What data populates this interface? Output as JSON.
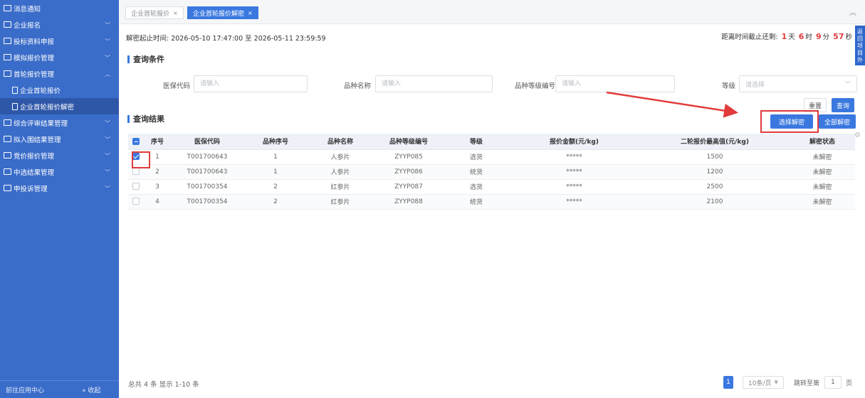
{
  "sidebar": {
    "items": [
      {
        "label": "消息通知",
        "chevron": ""
      },
      {
        "label": "企业报名",
        "chevron": "﹀"
      },
      {
        "label": "投标资料申报",
        "chevron": "﹀"
      },
      {
        "label": "模拟报价管理",
        "chevron": "﹀"
      },
      {
        "label": "首轮报价管理",
        "chevron": "︿"
      },
      {
        "label": "企业首轮报价",
        "chevron": ""
      },
      {
        "label": "企业首轮报价解密",
        "chevron": ""
      },
      {
        "label": "综合评审结果管理",
        "chevron": "﹀"
      },
      {
        "label": "拟入围结果管理",
        "chevron": "﹀"
      },
      {
        "label": "竞价报价管理",
        "chevron": "﹀"
      },
      {
        "label": "中选结果管理",
        "chevron": "﹀"
      },
      {
        "label": "申投诉管理",
        "chevron": "﹀"
      }
    ],
    "bottom_left": "前往应用中心",
    "bottom_right": "« 收起"
  },
  "tabs": [
    {
      "label": "企业首轮报价",
      "close": "×"
    },
    {
      "label": "企业首轮报价解密",
      "close": "×"
    }
  ],
  "top_chevron": "︽",
  "side_float": "返回项目外",
  "info": {
    "decrypt_period": "解密起止时间: 2026-05-10 17:47:00 至 2026-05-11 23:59:59",
    "countdown_prefix": "距离时间截止还剩:",
    "days": "1",
    "days_unit": "天",
    "hours": "6",
    "hours_unit": "时",
    "minutes": "9",
    "minutes_unit": "分",
    "seconds": "57",
    "seconds_unit": "秒"
  },
  "query": {
    "title": "查询条件",
    "fields": [
      {
        "label": "医保代码",
        "placeholder": "请输入"
      },
      {
        "label": "品种名称",
        "placeholder": "请输入"
      },
      {
        "label": "品种等级编号",
        "placeholder": "请输入"
      },
      {
        "label": "等级",
        "placeholder": "请选择"
      }
    ],
    "reset_label": "重置",
    "search_label": "查询"
  },
  "results": {
    "title": "查询结果",
    "select_decrypt_label": "选择解密",
    "decrypt_all_label": "全部解密",
    "columns": [
      "序号",
      "医保代码",
      "品种序号",
      "品种名称",
      "品种等级编号",
      "等级",
      "报价金额(元/kg)",
      "二轮报价最高值(元/kg)",
      "解密状态"
    ],
    "rows": [
      {
        "checked": true,
        "cells": [
          "1",
          "T001700643",
          "1",
          "人参片",
          "ZYYP085",
          "选货",
          "*****",
          "1500",
          "未解密"
        ]
      },
      {
        "checked": false,
        "cells": [
          "2",
          "T001700643",
          "1",
          "人参片",
          "ZYYP086",
          "统货",
          "*****",
          "1200",
          "未解密"
        ]
      },
      {
        "checked": false,
        "cells": [
          "3",
          "T001700354",
          "2",
          "红参片",
          "ZYYP087",
          "选货",
          "*****",
          "2500",
          "未解密"
        ]
      },
      {
        "checked": false,
        "cells": [
          "4",
          "T001700354",
          "2",
          "红参片",
          "ZYYP088",
          "统货",
          "*****",
          "2100",
          "未解密"
        ]
      }
    ]
  },
  "footer": {
    "total": "总共 4 条 显示 1-10 条",
    "current_page": "1",
    "page_size": "10条/页",
    "jump_label": "跳转至第",
    "jump_value": "1",
    "jump_unit": "页"
  },
  "colors": {
    "sidebar": "#3a6cc9",
    "primary": "#3a78e0",
    "highlight": "#e23b3b"
  }
}
